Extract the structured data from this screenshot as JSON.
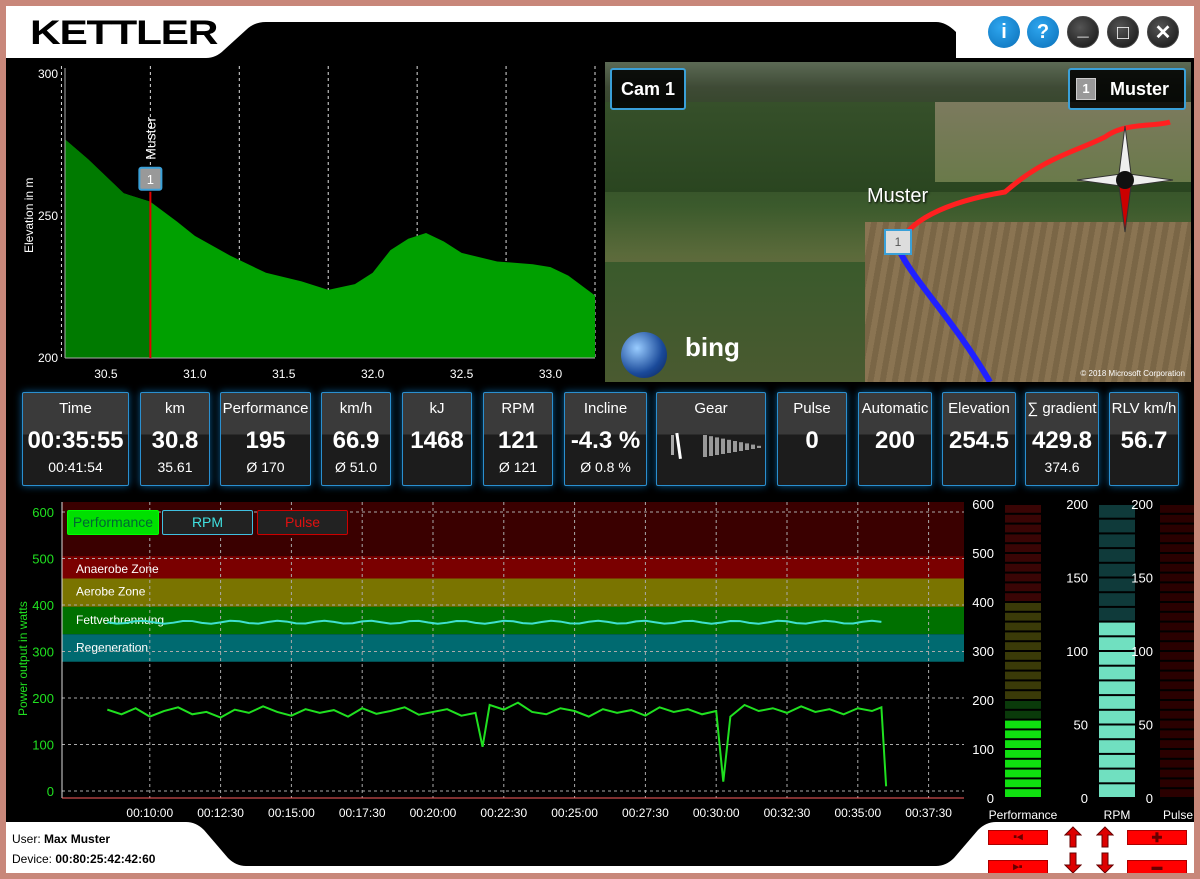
{
  "window": {
    "logo": "KETTLER",
    "buttons": [
      {
        "name": "info",
        "glyph": "i"
      },
      {
        "name": "help",
        "glyph": "?"
      },
      {
        "name": "minimize",
        "glyph": "_"
      },
      {
        "name": "maximize",
        "glyph": "□"
      },
      {
        "name": "close",
        "glyph": "✕"
      }
    ]
  },
  "elevation_chart": {
    "type": "area",
    "ylabel": "Elevation in m",
    "ylim": [
      200,
      300
    ],
    "yticks": [
      "300",
      "250",
      "200"
    ],
    "xlim": [
      30.27,
      33.25
    ],
    "xticks": [
      "30.5",
      "31.0",
      "31.5",
      "32.0",
      "32.5",
      "33.0"
    ],
    "fill_color": "#00a000",
    "position_marker": {
      "label": "Muster",
      "badge": "1",
      "km": 30.75
    },
    "x": [
      30.27,
      30.4,
      30.5,
      30.6,
      30.75,
      30.9,
      31.0,
      31.2,
      31.4,
      31.6,
      31.75,
      31.9,
      32.0,
      32.1,
      32.2,
      32.3,
      32.4,
      32.5,
      32.7,
      32.9,
      33.0,
      33.1,
      33.25
    ],
    "y": [
      277,
      270,
      264,
      258,
      255,
      248,
      243,
      236,
      230,
      227,
      224,
      226,
      230,
      238,
      242,
      244,
      241,
      237,
      234,
      233,
      232,
      229,
      222
    ]
  },
  "map": {
    "camera": "Cam 1",
    "rider_badge": "1",
    "rider_name": "Muster",
    "map_label": "Muster",
    "provider": "bing",
    "copyright": "© 2018 Microsoft Corporation"
  },
  "tiles": [
    {
      "label": "Time",
      "value": "00:35:55",
      "sub": "00:41:54"
    },
    {
      "label": "km",
      "value": "30.8",
      "sub": "35.61"
    },
    {
      "label": "Performance",
      "value": "195",
      "sub": "Ø 170"
    },
    {
      "label": "km/h",
      "value": "66.9",
      "sub": "Ø 51.0"
    },
    {
      "label": "kJ",
      "value": "1468",
      "sub": ""
    },
    {
      "label": "RPM",
      "value": "121",
      "sub": "Ø 121"
    },
    {
      "label": "Incline",
      "value": "-4.3 %",
      "sub": "Ø 0.8 %"
    },
    {
      "label": "Gear",
      "value": "",
      "sub": ""
    },
    {
      "label": "Pulse",
      "value": "0",
      "sub": ""
    },
    {
      "label": "Automatic",
      "value": "200",
      "sub": ""
    },
    {
      "label": "Elevation",
      "value": "254.5",
      "sub": ""
    },
    {
      "label": "∑ gradient",
      "value": "429.8",
      "sub": "374.6"
    },
    {
      "label": "RLV km/h",
      "value": "56.7",
      "sub": ""
    }
  ],
  "chart_data": {
    "type": "line",
    "ylabel": "Power output in watts",
    "ylim": [
      0,
      600
    ],
    "yticks": [
      "0",
      "100",
      "200",
      "300",
      "400",
      "500",
      "600"
    ],
    "xticks": [
      "00:10:00",
      "00:12:30",
      "00:15:00",
      "00:17:30",
      "00:20:00",
      "00:22:30",
      "00:25:00",
      "00:27:30",
      "00:30:00",
      "00:32:30",
      "00:35:00",
      "00:37:30"
    ],
    "legend": [
      {
        "label": "Performance",
        "color": "#00ff00",
        "active": true
      },
      {
        "label": "RPM",
        "color": "#40e0e0",
        "active": false
      },
      {
        "label": "Pulse",
        "color": "#e01010",
        "active": false
      }
    ],
    "zones": [
      {
        "label": "Anaerobe Zone",
        "color": "#7a0000"
      },
      {
        "label": "Aerobe Zone",
        "color": "#7a7400"
      },
      {
        "label": "Fettverbrennung",
        "color": "#007000"
      },
      {
        "label": "Regeneration",
        "color": "#006a70"
      }
    ],
    "series": [
      {
        "name": "Performance",
        "color": "#20e020",
        "x": [
          "00:08:30",
          "00:09:00",
          "00:09:30",
          "00:10:00",
          "00:10:30",
          "00:11:00",
          "00:11:30",
          "00:12:00",
          "00:12:30",
          "00:13:00",
          "00:13:30",
          "00:14:00",
          "00:14:30",
          "00:15:00",
          "00:15:30",
          "00:16:00",
          "00:16:30",
          "00:17:00",
          "00:17:30",
          "00:18:00",
          "00:18:30",
          "00:19:00",
          "00:19:30",
          "00:20:00",
          "00:20:30",
          "00:21:00",
          "00:21:30",
          "00:21:45",
          "00:22:00",
          "00:22:30",
          "00:23:00",
          "00:23:30",
          "00:24:00",
          "00:24:30",
          "00:25:00",
          "00:25:30",
          "00:26:00",
          "00:26:30",
          "00:27:00",
          "00:27:30",
          "00:28:00",
          "00:28:30",
          "00:29:00",
          "00:29:30",
          "00:30:00",
          "00:30:15",
          "00:30:30",
          "00:31:00",
          "00:31:30",
          "00:32:00",
          "00:32:30",
          "00:33:00",
          "00:33:30",
          "00:34:00",
          "00:34:30",
          "00:35:00",
          "00:35:30",
          "00:35:50",
          "00:36:00"
        ],
        "y": [
          175,
          165,
          178,
          160,
          172,
          180,
          165,
          170,
          158,
          175,
          168,
          182,
          170,
          162,
          176,
          168,
          174,
          160,
          178,
          166,
          172,
          180,
          164,
          170,
          176,
          162,
          168,
          95,
          185,
          175,
          190,
          170,
          165,
          178,
          172,
          160,
          176,
          168,
          174,
          162,
          180,
          170,
          176,
          165,
          172,
          20,
          160,
          185,
          172,
          178,
          168,
          182,
          170,
          176,
          165,
          178,
          172,
          180,
          10
        ]
      },
      {
        "name": "RPM",
        "color": "#40e0d0",
        "x": [
          "00:08:30",
          "00:36:00"
        ],
        "y": [
          121,
          121
        ]
      }
    ]
  },
  "gauges": [
    {
      "label": "Performance",
      "ticks": [
        "600",
        "500",
        "400",
        "300",
        "200",
        "100",
        "0"
      ],
      "max": 600,
      "value": 150
    },
    {
      "label": "RPM",
      "ticks": [
        "200",
        "150",
        "100",
        "50",
        "0"
      ],
      "max": 200,
      "value": 121
    },
    {
      "label": "Pulse",
      "ticks": [
        "200",
        "150",
        "100",
        "50",
        "0"
      ],
      "max": 200,
      "value": 0
    }
  ],
  "footer": {
    "user_label": "User:",
    "user": "Max Muster",
    "device_label": "Device:",
    "device": "00:80:25:42:42:60"
  }
}
